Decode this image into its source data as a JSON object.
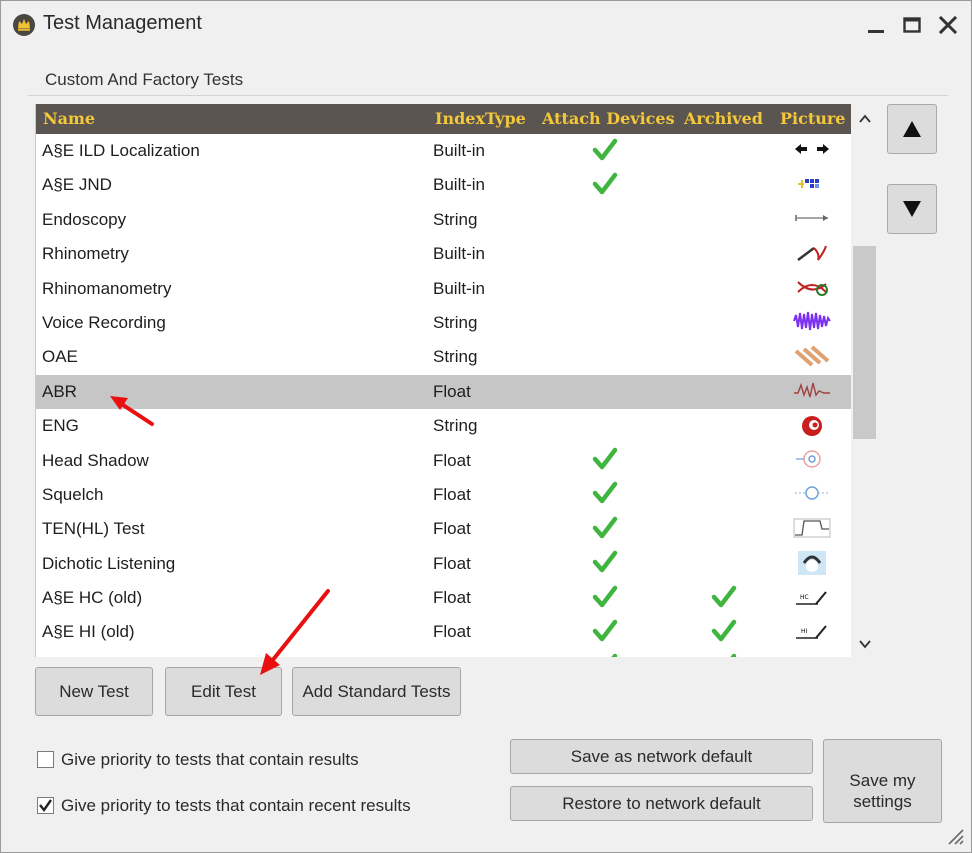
{
  "window": {
    "title": "Test Management",
    "app_icon": "crown-badge-icon",
    "controls": [
      "minimize-icon",
      "maximize-icon",
      "close-icon"
    ]
  },
  "section": {
    "label": "Custom And Factory Tests"
  },
  "grid": {
    "columns": [
      "Name",
      "IndexType",
      "Attach Devices",
      "Archived",
      "Picture"
    ],
    "rows": [
      {
        "name": "A§E ILD Localization",
        "index_type": "Built-in",
        "attach": true,
        "archived": false,
        "picture": "arrows-left-right-icon"
      },
      {
        "name": "A§E JND",
        "index_type": "Built-in",
        "attach": true,
        "archived": false,
        "picture": "grid-blocks-icon"
      },
      {
        "name": "Endoscopy",
        "index_type": "String",
        "attach": false,
        "archived": false,
        "picture": "endoscope-icon"
      },
      {
        "name": "Rhinometry",
        "index_type": "Built-in",
        "attach": false,
        "archived": false,
        "picture": "rhinometry-icon"
      },
      {
        "name": "Rhinomanometry",
        "index_type": "Built-in",
        "attach": false,
        "archived": false,
        "picture": "rhinomanometry-icon"
      },
      {
        "name": "Voice Recording",
        "index_type": "String",
        "attach": false,
        "archived": false,
        "picture": "waveform-icon"
      },
      {
        "name": "OAE",
        "index_type": "String",
        "attach": false,
        "archived": false,
        "picture": "probes-icon"
      },
      {
        "name": "ABR",
        "index_type": "Float",
        "attach": false,
        "archived": false,
        "picture": "abr-wave-icon",
        "selected": true
      },
      {
        "name": "ENG",
        "index_type": "String",
        "attach": false,
        "archived": false,
        "picture": "cochlea-icon"
      },
      {
        "name": "Head Shadow",
        "index_type": "Float",
        "attach": true,
        "archived": false,
        "picture": "head-shadow-icon"
      },
      {
        "name": "Squelch",
        "index_type": "Float",
        "attach": true,
        "archived": false,
        "picture": "squelch-icon"
      },
      {
        "name": "TEN(HL) Test",
        "index_type": "Float",
        "attach": true,
        "archived": false,
        "picture": "ten-curve-icon"
      },
      {
        "name": "Dichotic Listening",
        "index_type": "Float",
        "attach": true,
        "archived": false,
        "picture": "headphones-face-icon"
      },
      {
        "name": "A§E HC (old)",
        "index_type": "Float",
        "attach": true,
        "archived": true,
        "picture": "hc-slope-icon"
      },
      {
        "name": "A§E HI (old)",
        "index_type": "Float",
        "attach": true,
        "archived": true,
        "picture": "hi-slope-icon"
      },
      {
        "name": "",
        "index_type": "",
        "attach": true,
        "archived": true,
        "picture": ""
      }
    ]
  },
  "scroll": {
    "up": "scroll-up-icon",
    "down": "scroll-down-icon"
  },
  "move": {
    "up": "triangle-up-icon",
    "down": "triangle-down-icon"
  },
  "buttons": {
    "new_test": "New Test",
    "edit_test": "Edit Test",
    "add_standard": "Add Standard Tests",
    "save_network": "Save as network default",
    "restore_network": "Restore to network default",
    "save_my_line1": "Save my",
    "save_my_line2": "settings"
  },
  "options": {
    "priority_results": {
      "label": "Give priority to tests that contain results",
      "checked": false
    },
    "priority_recent": {
      "label": "Give priority to tests that contain recent results",
      "checked": true
    }
  },
  "colors": {
    "header_bg": "#5a5550",
    "header_text": "#f4c83a",
    "check": "#3fb53f",
    "annotation": "#e81010",
    "selected_row": "#c6c6c6"
  }
}
